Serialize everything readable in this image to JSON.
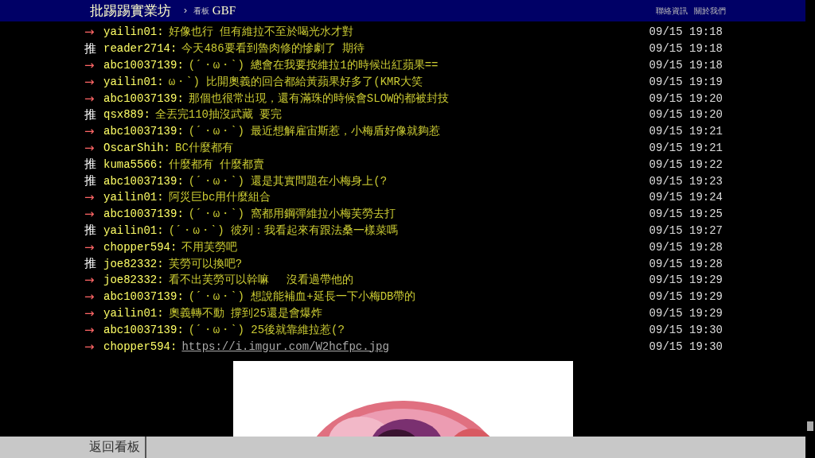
{
  "header": {
    "site": "批踢踢實業坊",
    "separator": "›",
    "board_label": "看板",
    "board": "GBF",
    "links": [
      "聯絡資訊",
      "關於我們"
    ]
  },
  "pushes": [
    {
      "kind": "arrow",
      "tag": "→",
      "user": "yailin01:",
      "content": "好像也行 但有維拉不至於喝光水才對",
      "time": "09/15 19:18"
    },
    {
      "kind": "push",
      "tag": "推",
      "user": "reader2714:",
      "content": "今天486要看到魯肉修的慘劇了 期待",
      "time": "09/15 19:18"
    },
    {
      "kind": "arrow",
      "tag": "→",
      "user": "abc10037139:",
      "content": "(ˊ・ω・ˋ) 總會在我要按維拉1的時候出紅蘋果==",
      "time": "09/15 19:18"
    },
    {
      "kind": "arrow",
      "tag": "→",
      "user": "yailin01:",
      "content": "ω・ˋ) 比開奧義的回合都給黃蘋果好多了(KMR大笑",
      "time": "09/15 19:19"
    },
    {
      "kind": "arrow",
      "tag": "→",
      "user": "abc10037139:",
      "content": "那個也很常出現，還有滿珠的時候會SLOW的都被封技",
      "time": "09/15 19:20"
    },
    {
      "kind": "push",
      "tag": "推",
      "user": "qsx889:",
      "content": "全丟完110抽沒武藏 要完",
      "time": "09/15 19:20"
    },
    {
      "kind": "arrow",
      "tag": "→",
      "user": "abc10037139:",
      "content": "(ˊ・ω・ˋ) 最近想解雇宙斯惹，小梅盾好像就夠惹",
      "time": "09/15 19:21"
    },
    {
      "kind": "arrow",
      "tag": "→",
      "user": "OscarShih:",
      "content": "BC什麼都有",
      "time": "09/15 19:21"
    },
    {
      "kind": "push",
      "tag": "推",
      "user": "kuma5566:",
      "content": "什麼都有 什麼都賣",
      "time": "09/15 19:22"
    },
    {
      "kind": "push",
      "tag": "推",
      "user": "abc10037139:",
      "content": "(ˊ・ω・ˋ) 還是其實問題在小梅身上(?",
      "time": "09/15 19:23"
    },
    {
      "kind": "arrow",
      "tag": "→",
      "user": "yailin01:",
      "content": "阿災巨bc用什麼組合",
      "time": "09/15 19:24"
    },
    {
      "kind": "arrow",
      "tag": "→",
      "user": "abc10037139:",
      "content": "(ˊ・ω・ˋ) 窩都用鋼彈維拉小梅芙勞去打",
      "time": "09/15 19:25"
    },
    {
      "kind": "push",
      "tag": "推",
      "user": "yailin01:",
      "content": "(ˊ・ω・ˋ) 彼列：我看起來有跟法桑一樣菜嗎",
      "time": "09/15 19:27"
    },
    {
      "kind": "arrow",
      "tag": "→",
      "user": "chopper594:",
      "content": "不用芙勞吧",
      "time": "09/15 19:28"
    },
    {
      "kind": "push",
      "tag": "推",
      "user": "joe82332:",
      "content": "芙勞可以換吧?",
      "time": "09/15 19:28"
    },
    {
      "kind": "arrow",
      "tag": "→",
      "user": "joe82332:",
      "content": "看不出芙勞可以幹嘛　 沒看過帶他的",
      "time": "09/15 19:29"
    },
    {
      "kind": "arrow",
      "tag": "→",
      "user": "abc10037139:",
      "content": "(ˊ・ω・ˋ) 想說能補血+延長一下小梅DB帶的",
      "time": "09/15 19:29"
    },
    {
      "kind": "arrow",
      "tag": "→",
      "user": "yailin01:",
      "content": "奧義轉不動 撐到25還是會爆炸",
      "time": "09/15 19:29"
    },
    {
      "kind": "arrow",
      "tag": "→",
      "user": "abc10037139:",
      "content": "(ˊ・ω・ˋ) 25後就靠維拉惹(?",
      "time": "09/15 19:30"
    },
    {
      "kind": "arrow",
      "tag": "→",
      "user": "chopper594:",
      "link": "https://i.imgur.com/W2hcfpc.jpg",
      "time": "09/15 19:30"
    }
  ],
  "footer": {
    "back": "返回看板"
  }
}
